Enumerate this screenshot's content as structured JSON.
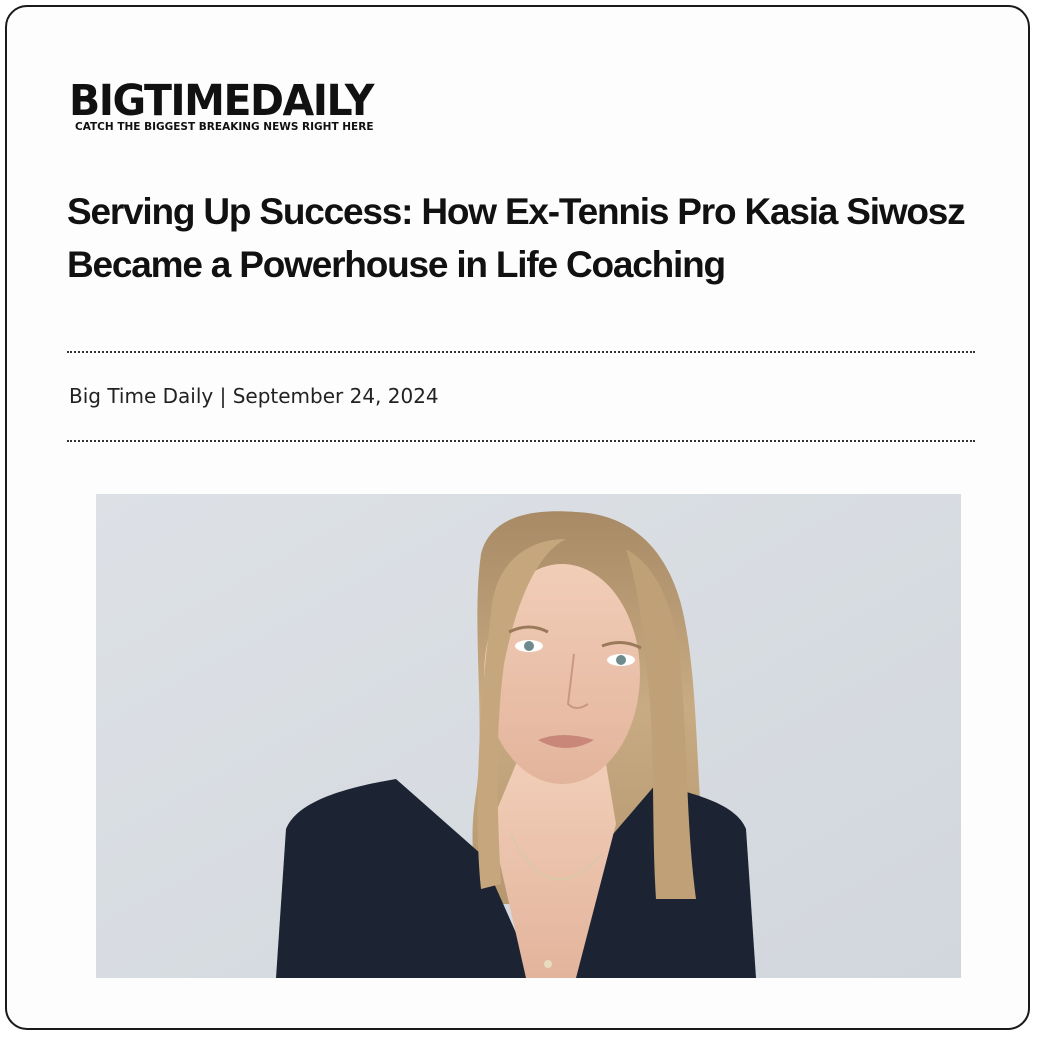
{
  "logo": {
    "wordmark": "BIGTIMEDAILY",
    "tagline": "CATCH THE BIGGEST BREAKING NEWS RIGHT HERE"
  },
  "article": {
    "headline_line1": "Serving Up Success: How Ex-Tennis Pro Kasia Siwosz",
    "headline_line2": "Became a Powerhouse in Life Coaching",
    "byline": "Big Time Daily | September 24, 2024"
  },
  "colors": {
    "border": "#1a1a1a",
    "text": "#111111",
    "photo_background": "#d9dde2",
    "jacket": "#1c2433",
    "hair": "#b89a72"
  }
}
